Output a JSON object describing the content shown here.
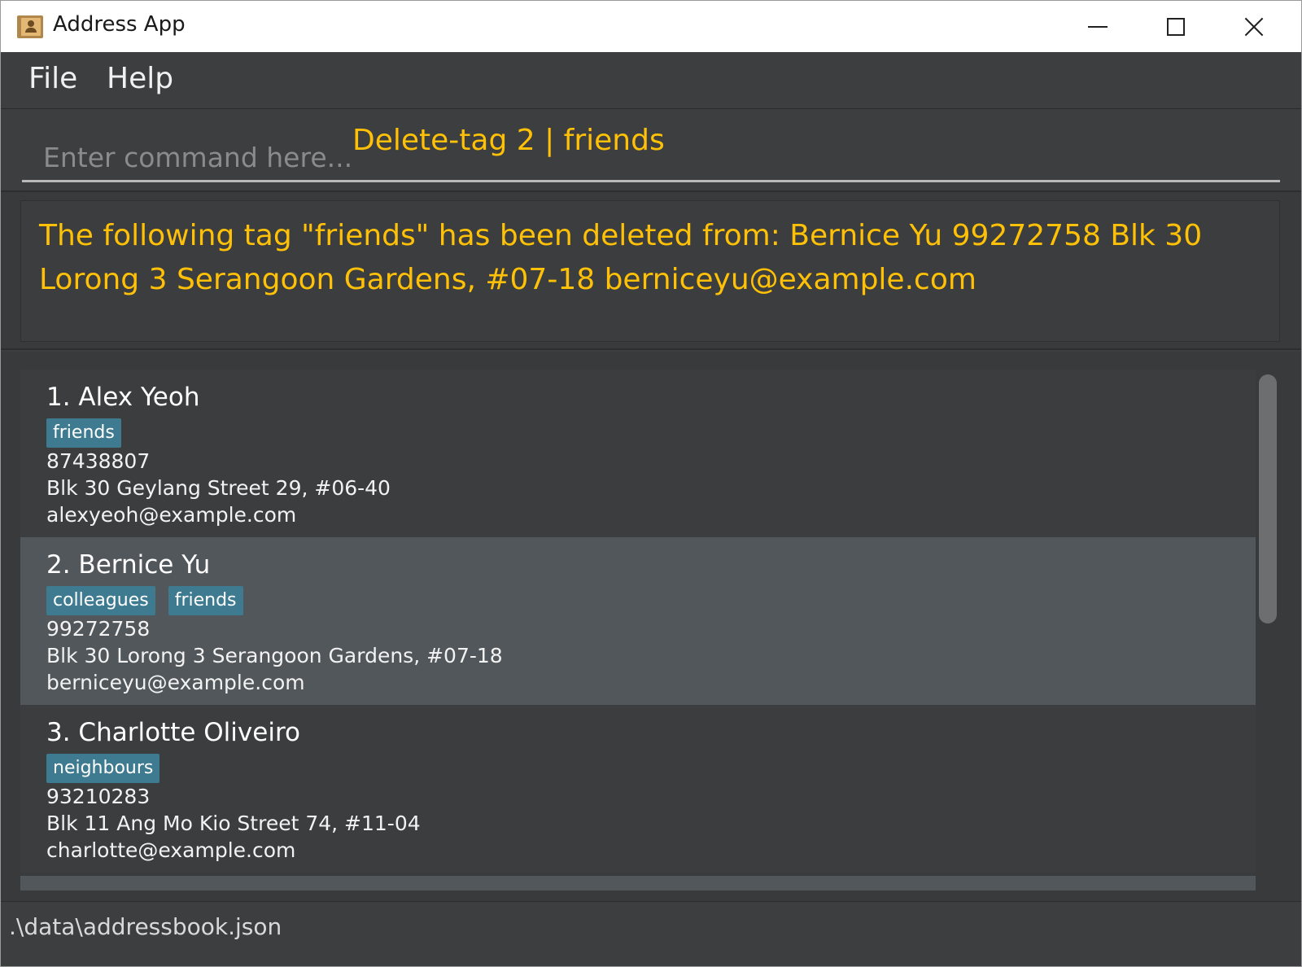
{
  "window": {
    "title": "Address App",
    "icon": "address-book-icon"
  },
  "menu": {
    "file": "File",
    "help": "Help"
  },
  "command": {
    "placeholder": "Enter command here...",
    "value": "Delete-tag 2 | friends"
  },
  "result": {
    "message": "The following tag \"friends\" has been deleted from: Bernice Yu 99272758 Blk 30 Lorong 3 Serangoon Gardens, #07-18 berniceyu@example.com"
  },
  "persons": [
    {
      "name": "1.  Alex Yeoh",
      "tags": [
        "friends"
      ],
      "phone": "87438807",
      "address": "Blk 30 Geylang Street 29, #06-40",
      "email": "alexyeoh@example.com",
      "selected": false
    },
    {
      "name": "2.  Bernice Yu",
      "tags": [
        "colleagues",
        "friends"
      ],
      "phone": "99272758",
      "address": "Blk 30 Lorong 3 Serangoon Gardens, #07-18",
      "email": "berniceyu@example.com",
      "selected": true
    },
    {
      "name": "3.  Charlotte Oliveiro",
      "tags": [
        "neighbours"
      ],
      "phone": "93210283",
      "address": "Blk 11 Ang Mo Kio Street 74, #11-04",
      "email": "charlotte@example.com",
      "selected": false
    }
  ],
  "status": {
    "file_path": ".\\data\\addressbook.json"
  },
  "colors": {
    "accent": "#ffc107",
    "tag": "#3e7b91",
    "background": "#3c3e3f",
    "selected_row": "#52575b"
  }
}
